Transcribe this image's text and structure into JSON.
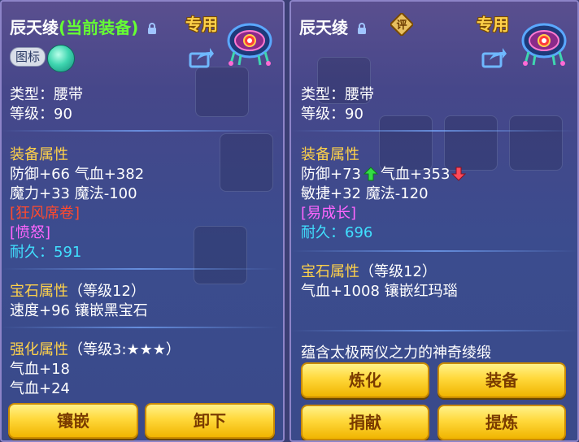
{
  "left": {
    "title_name": "辰天绫",
    "title_suffix": "(当前装备)",
    "tag": "专用",
    "icon_toggle_label": "图标",
    "type_line": "类型：腰带",
    "level_line": "等级：90",
    "equip_attr_title": "装备属性",
    "attr_line1": "防御+66 气血+382",
    "attr_line2": "魔力+33 魔法-100",
    "special_skill": "[狂风席卷]",
    "special_effect": "[愤怒]",
    "durability": "耐久：591",
    "gem_title": "宝石属性",
    "gem_level": "（等级12）",
    "gem_line": "速度+96 镶嵌黑宝石",
    "enhance_title": "强化属性",
    "enhance_level": "（等级3:★★★）",
    "enhance_line1": "气血+18",
    "enhance_line2": "气血+24",
    "buttons": [
      "镶嵌",
      "卸下"
    ]
  },
  "right": {
    "title_name": "辰天绫",
    "tag": "专用",
    "rate_badge": "评",
    "type_line": "类型：腰带",
    "level_line": "等级：90",
    "equip_attr_title": "装备属性",
    "attr_line1_a": "防御+73",
    "attr_line1_b": "气血+353",
    "attr_line2": "敏捷+32 魔法-120",
    "special_skill": "[易成长]",
    "durability": "耐久：696",
    "gem_title": "宝石属性",
    "gem_level": "（等级12）",
    "gem_line": "气血+1008 镶嵌红玛瑙",
    "description": "蕴含太极两仪之力的神奇绫缎",
    "buttons": [
      "炼化",
      "装备",
      "捐献",
      "提炼"
    ]
  },
  "icons": [
    "lock-icon",
    "share-icon",
    "item-belt-icon",
    "rate-badge-icon",
    "up-arrow-icon",
    "down-arrow-icon"
  ],
  "colors": {
    "gold": "#ffd24a",
    "red": "#ff4a2e",
    "purple": "#ff66ff",
    "cyan": "#40e0ff",
    "green": "#66ff33"
  }
}
